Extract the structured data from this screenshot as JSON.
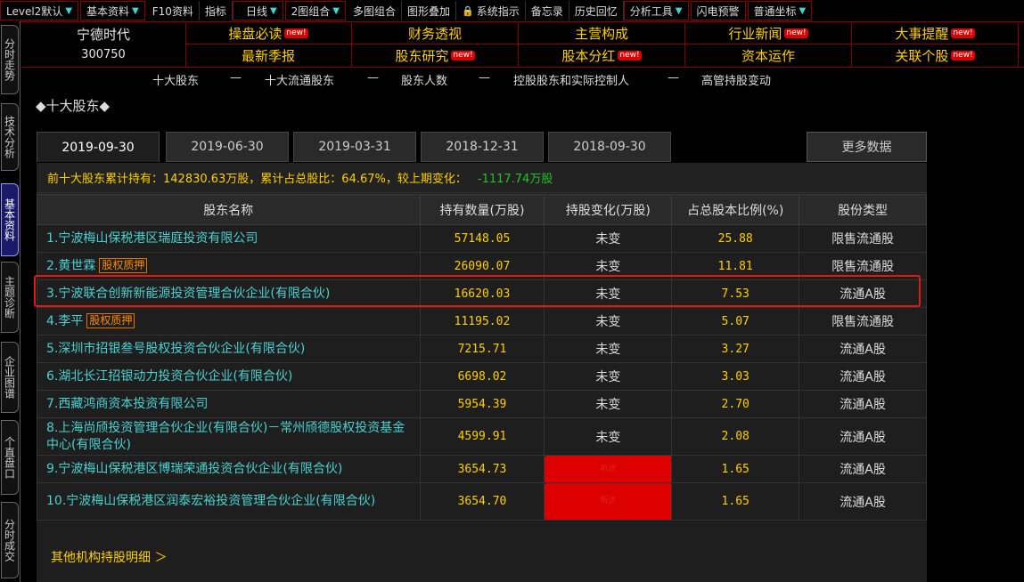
{
  "toolbar": {
    "items": [
      "Level2默认",
      "基本资料",
      "F10资料",
      "指标",
      "日线",
      "2图组合",
      "多图组合",
      "图形叠加",
      "系统指示",
      "备忘录",
      "历史回忆",
      "分析工具",
      "闪电预警",
      "普通坐标"
    ]
  },
  "sidetabs": [
    "分时走势",
    "技术分析",
    "基本资料",
    "主题诊断",
    "企业图谱",
    "个直盘口",
    "分时成交"
  ],
  "stock": {
    "name": "宁德时代",
    "code": "300750"
  },
  "nav_row1": [
    {
      "label": "操盘必读",
      "new": "new!"
    },
    {
      "label": "财务透视",
      "new": ""
    },
    {
      "label": "主营构成",
      "new": ""
    },
    {
      "label": "行业新闻",
      "new": "new!"
    },
    {
      "label": "大事提醒",
      "new": "new!"
    }
  ],
  "nav_row2": [
    {
      "label": "最新季报",
      "new": ""
    },
    {
      "label": "股东研究",
      "new": "new!"
    },
    {
      "label": "股本分红",
      "new": "new!"
    },
    {
      "label": "资本运作",
      "new": ""
    },
    {
      "label": "关联个股",
      "new": "new!"
    }
  ],
  "subnav": [
    "十大股东",
    "—",
    "十大流通股东",
    "—",
    "股东人数",
    "—",
    "控股股东和实际控制人",
    "—",
    "高管持股变动"
  ],
  "section_title": "◆十大股东◆",
  "date_tabs": [
    "2019-09-30",
    "2019-06-30",
    "2019-03-31",
    "2018-12-31",
    "2018-09-30"
  ],
  "more_label": "更多数据",
  "summary": {
    "text": "前十大股东累计持有：142830.63万股，累计占总股比：64.67%，较上期变化：",
    "change": "-1117.74万股"
  },
  "columns": [
    "股东名称",
    "持有数量(万股)",
    "持股变化(万股)",
    "占总股本比例(%)",
    "股份类型"
  ],
  "rows": [
    {
      "name": "1.宁波梅山保税港区瑞庭投资有限公司",
      "tag": "",
      "qty": "57148.05",
      "chg": "未变",
      "pct": "25.88",
      "type": "限售流通股"
    },
    {
      "name": "2.黄世霖",
      "tag": "股权质押",
      "qty": "26090.07",
      "chg": "未变",
      "pct": "11.81",
      "type": "限售流通股"
    },
    {
      "name": "3.宁波联合创新新能源投资管理合伙企业(有限合伙)",
      "tag": "",
      "qty": "16620.03",
      "chg": "未变",
      "pct": "7.53",
      "type": "流通A股"
    },
    {
      "name": "4.李平",
      "tag": "股权质押",
      "qty": "11195.02",
      "chg": "未变",
      "pct": "5.07",
      "type": "限售流通股"
    },
    {
      "name": "5.深圳市招银叁号股权投资合伙企业(有限合伙)",
      "tag": "",
      "qty": "7215.71",
      "chg": "未变",
      "pct": "3.27",
      "type": "流通A股"
    },
    {
      "name": "6.湖北长江招银动力投资合伙企业(有限合伙)",
      "tag": "",
      "qty": "6698.02",
      "chg": "未变",
      "pct": "3.03",
      "type": "流通A股"
    },
    {
      "name": "7.西藏鸿商资本投资有限公司",
      "tag": "",
      "qty": "5954.39",
      "chg": "未变",
      "pct": "2.70",
      "type": "流通A股"
    },
    {
      "name": "8.上海尚颀投资管理合伙企业(有限合伙)－常州颀德股权投资基金中心(有限合伙)",
      "tag": "",
      "qty": "4599.91",
      "chg": "未变",
      "pct": "2.08",
      "type": "流通A股"
    },
    {
      "name": "9.宁波梅山保税港区博瑞荣通投资合伙企业(有限合伙)",
      "tag": "",
      "qty": "3654.73",
      "chg": "新进",
      "pct": "1.65",
      "type": "流通A股"
    },
    {
      "name": "10.宁波梅山保税港区润泰宏裕投资管理合伙企业(有限合伙)",
      "tag": "",
      "qty": "3654.70",
      "chg": "新进",
      "pct": "1.65",
      "type": "流通A股"
    }
  ],
  "others_link": "其他机构持股明细 ＞",
  "colors": {
    "accent": "#ffd000",
    "link": "#4ad1d1",
    "new": "#e02020",
    "gain": "#22c322",
    "highlight": "#e01818"
  }
}
